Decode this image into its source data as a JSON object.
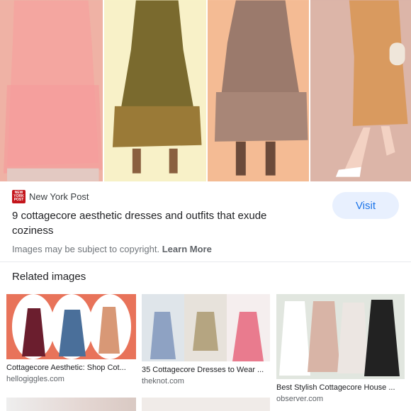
{
  "result": {
    "source_name": "New York Post",
    "source_logo_text": "NEW YORK POST",
    "title": "9 cottagecore aesthetic dresses and outfits that exude coziness",
    "visit_label": "Visit",
    "copyright_text": "Images may be subject to copyright.",
    "learn_more_label": "Learn More"
  },
  "related": {
    "heading": "Related images",
    "items": [
      {
        "caption": "Cottagecore Aesthetic: Shop Cot...",
        "domain": "hellogiggles.com"
      },
      {
        "caption": "35 Cottagecore Dresses to Wear ...",
        "domain": "theknot.com"
      },
      {
        "caption": "Best Stylish Cottagecore House ...",
        "domain": "observer.com"
      }
    ]
  },
  "colors": {
    "accent": "#1a73e8",
    "visit_bg": "#e8f0fe",
    "logo_red": "#c4161c"
  }
}
